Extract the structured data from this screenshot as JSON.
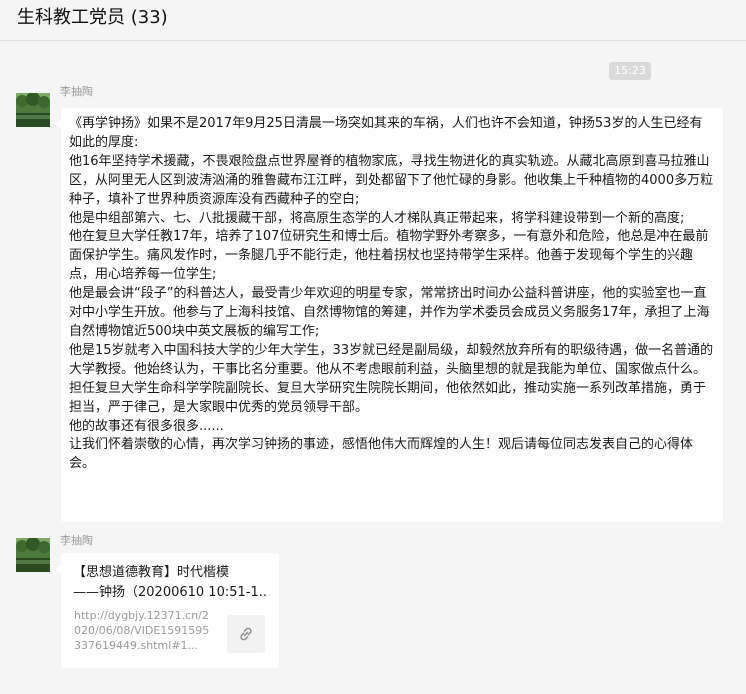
{
  "header": {
    "title": "生科教工党员 (33)"
  },
  "messages": {
    "time": "15:23",
    "first": {
      "sender": "李抽陶",
      "lines": [
        "《再学钟扬》如果不是2017年9月25日清晨一场突如其来的车祸，人们也许不会知道，钟扬53岁的人生已经有如此的厚度:",
        "他16年坚持学术援藏，不畏艰险盘点世界屋脊的植物家底，寻找生物进化的真实轨迹。从藏北高原到喜马拉雅山区，从阿里无人区到波涛汹涌的雅鲁藏布江江畔，到处都留下了他忙碌的身影。他收集上千种植物的4000多万粒种子，填补了世界种质资源库没有西藏种子的空白;",
        "他是中组部第六、七、八批援藏干部，将高原生态学的人才梯队真正带起来，将学科建设带到一个新的高度;",
        "他在复旦大学任教17年，培养了107位研究生和博士后。植物学野外考察多，一有意外和危险，他总是冲在最前面保护学生。痛风发作时，一条腿几乎不能行走，他柱着拐杖也坚持带学生采样。他善于发现每个学生的兴趣点，用心培养每一位学生;",
        "他是最会讲“段子”的科普达人，最受青少年欢迎的明星专家，常常挤出时间办公益科普讲座，他的实验室也一直对中小学生开放。他参与了上海科技馆、自然博物馆的筹建，并作为学术委员会成员义务服务17年，承担了上海自然博物馆近500块中英文展板的编写工作;",
        "他是15岁就考入中国科技大学的少年大学生，33岁就已经是副局级，却毅然放弃所有的职级待遇，做一名普通的大学教授。他始终认为，干事比名分重要。他从不考虑眼前利益，头脑里想的就是我能为单位、国家做点什么。担任复旦大学生命科学学院副院长、复旦大学研究生院院长期间，他依然如此，推动实施一系列改革措施，勇于担当，严于律己，是大家眼中优秀的党员领导干部。",
        "他的故事还有很多很多......",
        "让我们怀着崇敬的心情，再次学习钟扬的事迹，感悟他伟大而辉煌的人生！观后请每位同志发表自己的心得体会。"
      ]
    },
    "second": {
      "sender": "李抽陶",
      "link_title_line1": "【思想道德教育】时代楷模",
      "link_title_line2": "——钟扬（20200610 10:51-1...",
      "link_url": "http://dygbjy.12371.cn/2020/06/08/VIDE1591595337619449.shtml#1..."
    }
  },
  "icons": {
    "link": "link-icon",
    "avatar": "avatar-landscape"
  }
}
